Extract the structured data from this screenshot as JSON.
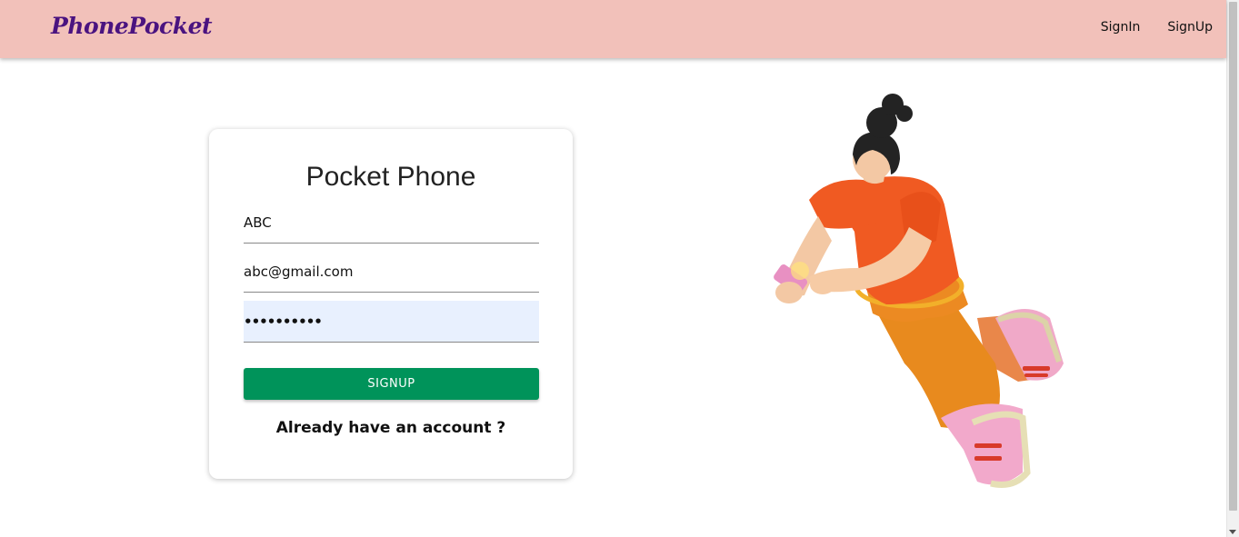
{
  "navbar": {
    "brand": "PhonePocket",
    "links": [
      "SignIn",
      "SignUp"
    ],
    "background": "#f2c1ba",
    "brand_color": "#4a1380"
  },
  "card": {
    "title": "Pocket Phone",
    "fields": {
      "name_value": "ABC",
      "email_value": "abc@gmail.com",
      "password_value": "••••••••••"
    },
    "button_label": "SIGNUP",
    "button_color": "#00935a",
    "account_link": "Already have an account ?"
  },
  "illustration": {
    "icon": "person-with-phone-illustration"
  }
}
